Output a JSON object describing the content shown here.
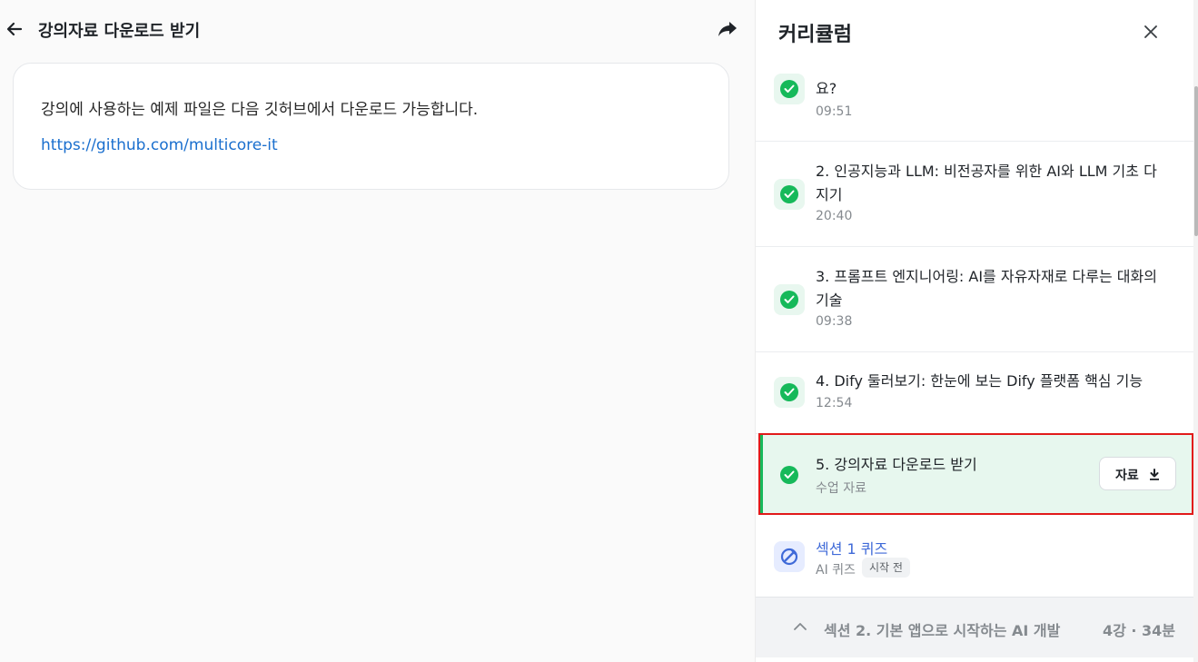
{
  "header": {
    "title": "강의자료 다운로드 받기",
    "back_icon": "arrow-left-icon",
    "share_icon": "share-arrow-icon"
  },
  "content": {
    "text": "강의에 사용하는 예제 파일은 다음 깃허브에서 다운로드 가능합니다.",
    "link": "https://github.com/multicore-it"
  },
  "curriculum": {
    "title": "커리큘럼",
    "close_icon": "close-icon",
    "items": [
      {
        "title": "요?",
        "duration": "09:51",
        "completed": true
      },
      {
        "title": "2. 인공지능과 LLM: 비전공자를 위한 AI와 LLM 기초 다지기",
        "duration": "20:40",
        "completed": true
      },
      {
        "title": "3. 프롬프트 엔지니어링: AI를 자유자재로 다루는 대화의 기술",
        "duration": "09:38",
        "completed": true
      },
      {
        "title": "4. Dify 둘러보기: 한눈에 보는 Dify 플랫폼 핵심 기능",
        "duration": "12:54",
        "completed": true
      },
      {
        "title": "5. 강의자료 다운로드 받기",
        "meta": "수업 자료",
        "completed": true,
        "active": true,
        "resource_label": "자료"
      }
    ],
    "quiz": {
      "title": "섹션 1 퀴즈",
      "type": "AI 퀴즈",
      "status": "시작 전"
    },
    "section2": {
      "title": "섹션 2. 기본 앱으로 시작하는 AI 개발",
      "stats": "4강 · 34분"
    }
  },
  "colors": {
    "accent_green": "#16b95a",
    "active_bg": "#e7f7ee",
    "link_blue": "#1a6fce",
    "quiz_blue": "#3f6ad8",
    "highlight_red": "#e11a1a"
  }
}
